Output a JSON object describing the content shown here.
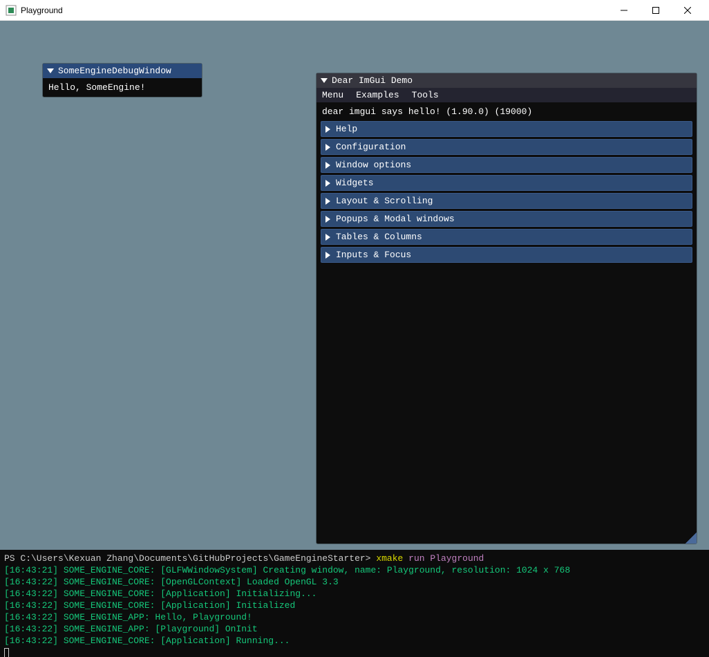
{
  "window": {
    "title": "Playground"
  },
  "debug_window": {
    "title": "SomeEngineDebugWindow",
    "text": "Hello, SomeEngine!"
  },
  "demo_window": {
    "title": "Dear ImGui Demo",
    "menu": [
      "Menu",
      "Examples",
      "Tools"
    ],
    "greeting": "dear imgui says hello! (1.90.0) (19000)",
    "headers": [
      "Help",
      "Configuration",
      "Window options",
      "Widgets",
      "Layout & Scrolling",
      "Popups & Modal windows",
      "Tables & Columns",
      "Inputs & Focus"
    ]
  },
  "terminal": {
    "prompt_path": "PS C:\\Users\\Kexuan Zhang\\Documents\\GitHubProjects\\GameEngineStarter>",
    "cmd": "xmake",
    "args": "run Playground",
    "logs": [
      "[16:43:21] SOME_ENGINE_CORE: [GLFWWindowSystem] Creating window, name: Playground, resolution: 1024 x 768",
      "[16:43:22] SOME_ENGINE_CORE: [OpenGLContext] Loaded OpenGL 3.3",
      "[16:43:22] SOME_ENGINE_CORE: [Application] Initializing...",
      "[16:43:22] SOME_ENGINE_CORE: [Application] Initialized",
      "[16:43:22] SOME_ENGINE_APP: Hello, Playground!",
      "[16:43:22] SOME_ENGINE_APP: [Playground] OnInit",
      "[16:43:22] SOME_ENGINE_CORE: [Application] Running..."
    ]
  }
}
